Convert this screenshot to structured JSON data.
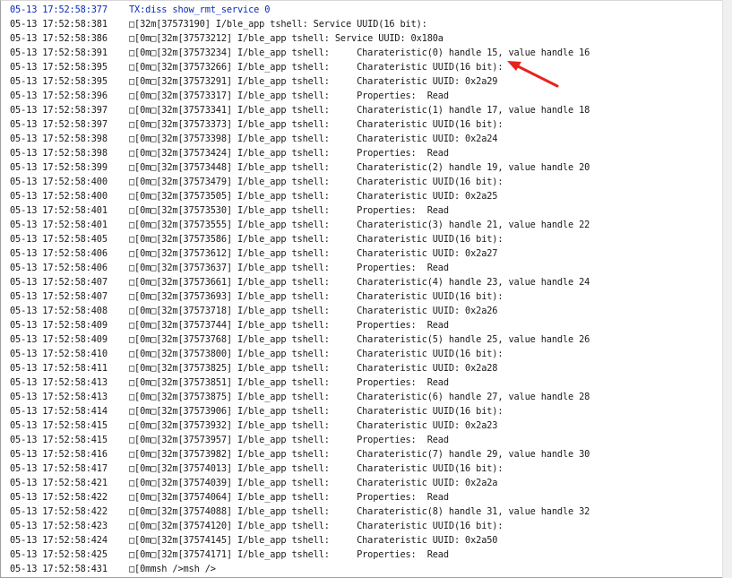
{
  "log": {
    "lines": [
      {
        "time": "05-13 17:52:58:377",
        "text": "TX:diss show_rmt_service 0"
      },
      {
        "time": "05-13 17:52:58:381",
        "text": "□[32m[37573190] I/ble_app tshell: Service UUID(16 bit):"
      },
      {
        "time": "05-13 17:52:58:386",
        "text": "□[0m□[32m[37573212] I/ble_app tshell: Service UUID: 0x180a"
      },
      {
        "time": "05-13 17:52:58:391",
        "text": "□[0m□[32m[37573234] I/ble_app tshell:     Charateristic(0) handle 15, value handle 16"
      },
      {
        "time": "05-13 17:52:58:395",
        "text": "□[0m□[32m[37573266] I/ble_app tshell:     Charateristic UUID(16 bit):"
      },
      {
        "time": "05-13 17:52:58:395",
        "text": "□[0m□[32m[37573291] I/ble_app tshell:     Charateristic UUID: 0x2a29"
      },
      {
        "time": "05-13 17:52:58:396",
        "text": "□[0m□[32m[37573317] I/ble_app tshell:     Properties:  Read"
      },
      {
        "time": "05-13 17:52:58:397",
        "text": "□[0m□[32m[37573341] I/ble_app tshell:     Charateristic(1) handle 17, value handle 18"
      },
      {
        "time": "05-13 17:52:58:397",
        "text": "□[0m□[32m[37573373] I/ble_app tshell:     Charateristic UUID(16 bit):"
      },
      {
        "time": "05-13 17:52:58:398",
        "text": "□[0m□[32m[37573398] I/ble_app tshell:     Charateristic UUID: 0x2a24"
      },
      {
        "time": "05-13 17:52:58:398",
        "text": "□[0m□[32m[37573424] I/ble_app tshell:     Properties:  Read"
      },
      {
        "time": "05-13 17:52:58:399",
        "text": "□[0m□[32m[37573448] I/ble_app tshell:     Charateristic(2) handle 19, value handle 20"
      },
      {
        "time": "05-13 17:52:58:400",
        "text": "□[0m□[32m[37573479] I/ble_app tshell:     Charateristic UUID(16 bit):"
      },
      {
        "time": "05-13 17:52:58:400",
        "text": "□[0m□[32m[37573505] I/ble_app tshell:     Charateristic UUID: 0x2a25"
      },
      {
        "time": "05-13 17:52:58:401",
        "text": "□[0m□[32m[37573530] I/ble_app tshell:     Properties:  Read"
      },
      {
        "time": "05-13 17:52:58:401",
        "text": "□[0m□[32m[37573555] I/ble_app tshell:     Charateristic(3) handle 21, value handle 22"
      },
      {
        "time": "05-13 17:52:58:405",
        "text": "□[0m□[32m[37573586] I/ble_app tshell:     Charateristic UUID(16 bit):"
      },
      {
        "time": "05-13 17:52:58:406",
        "text": "□[0m□[32m[37573612] I/ble_app tshell:     Charateristic UUID: 0x2a27"
      },
      {
        "time": "05-13 17:52:58:406",
        "text": "□[0m□[32m[37573637] I/ble_app tshell:     Properties:  Read"
      },
      {
        "time": "05-13 17:52:58:407",
        "text": "□[0m□[32m[37573661] I/ble_app tshell:     Charateristic(4) handle 23, value handle 24"
      },
      {
        "time": "05-13 17:52:58:407",
        "text": "□[0m□[32m[37573693] I/ble_app tshell:     Charateristic UUID(16 bit):"
      },
      {
        "time": "05-13 17:52:58:408",
        "text": "□[0m□[32m[37573718] I/ble_app tshell:     Charateristic UUID: 0x2a26"
      },
      {
        "time": "05-13 17:52:58:409",
        "text": "□[0m□[32m[37573744] I/ble_app tshell:     Properties:  Read"
      },
      {
        "time": "05-13 17:52:58:409",
        "text": "□[0m□[32m[37573768] I/ble_app tshell:     Charateristic(5) handle 25, value handle 26"
      },
      {
        "time": "05-13 17:52:58:410",
        "text": "□[0m□[32m[37573800] I/ble_app tshell:     Charateristic UUID(16 bit):"
      },
      {
        "time": "05-13 17:52:58:411",
        "text": "□[0m□[32m[37573825] I/ble_app tshell:     Charateristic UUID: 0x2a28"
      },
      {
        "time": "05-13 17:52:58:413",
        "text": "□[0m□[32m[37573851] I/ble_app tshell:     Properties:  Read"
      },
      {
        "time": "05-13 17:52:58:413",
        "text": "□[0m□[32m[37573875] I/ble_app tshell:     Charateristic(6) handle 27, value handle 28"
      },
      {
        "time": "05-13 17:52:58:414",
        "text": "□[0m□[32m[37573906] I/ble_app tshell:     Charateristic UUID(16 bit):"
      },
      {
        "time": "05-13 17:52:58:415",
        "text": "□[0m□[32m[37573932] I/ble_app tshell:     Charateristic UUID: 0x2a23"
      },
      {
        "time": "05-13 17:52:58:415",
        "text": "□[0m□[32m[37573957] I/ble_app tshell:     Properties:  Read"
      },
      {
        "time": "05-13 17:52:58:416",
        "text": "□[0m□[32m[37573982] I/ble_app tshell:     Charateristic(7) handle 29, value handle 30"
      },
      {
        "time": "05-13 17:52:58:417",
        "text": "□[0m□[32m[37574013] I/ble_app tshell:     Charateristic UUID(16 bit):"
      },
      {
        "time": "05-13 17:52:58:421",
        "text": "□[0m□[32m[37574039] I/ble_app tshell:     Charateristic UUID: 0x2a2a"
      },
      {
        "time": "05-13 17:52:58:422",
        "text": "□[0m□[32m[37574064] I/ble_app tshell:     Properties:  Read"
      },
      {
        "time": "05-13 17:52:58:422",
        "text": "□[0m□[32m[37574088] I/ble_app tshell:     Charateristic(8) handle 31, value handle 32"
      },
      {
        "time": "05-13 17:52:58:423",
        "text": "□[0m□[32m[37574120] I/ble_app tshell:     Charateristic UUID(16 bit):"
      },
      {
        "time": "05-13 17:52:58:424",
        "text": "□[0m□[32m[37574145] I/ble_app tshell:     Charateristic UUID: 0x2a50"
      },
      {
        "time": "05-13 17:52:58:425",
        "text": "□[0m□[32m[37574171] I/ble_app tshell:     Properties:  Read"
      },
      {
        "time": "05-13 17:52:58:431",
        "text": "□[0mmsh />msh />"
      }
    ]
  },
  "annotation": {
    "icon": "red-arrow-icon",
    "color": "#e8231d"
  },
  "colors": {
    "tx_text": "#0b2ab8",
    "log_text": "#1a1a1a"
  }
}
